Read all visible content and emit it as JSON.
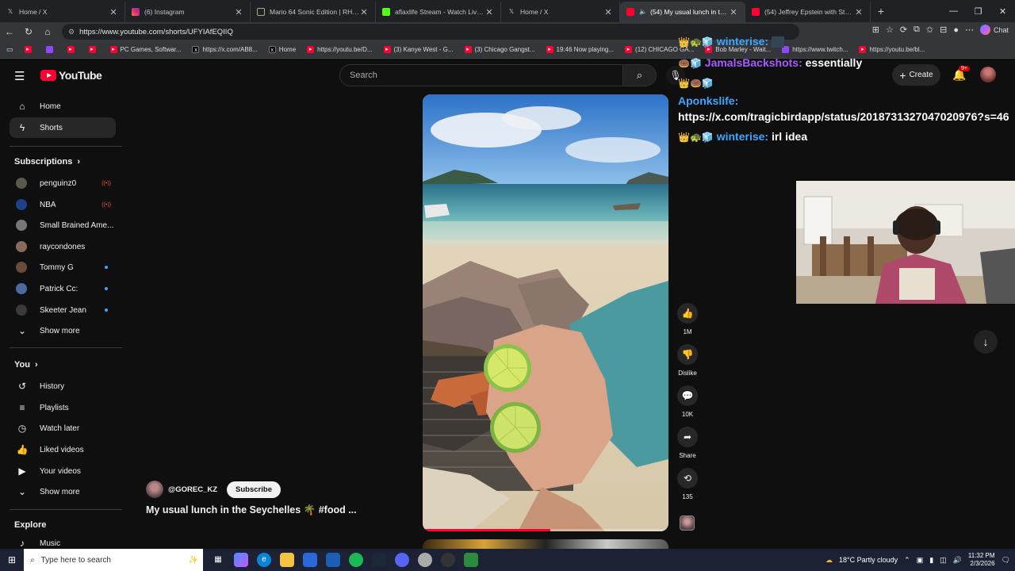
{
  "browser": {
    "tabs": [
      {
        "title": "Home / X",
        "icon": "x-logo-icon",
        "active": false
      },
      {
        "title": "(6) Instagram",
        "icon": "instagram-icon",
        "active": false
      },
      {
        "title": "Mario 64 Sonic Edition | RHDC",
        "icon": "rhdc-icon",
        "active": false
      },
      {
        "title": "aflaxlife Stream - Watch Live on K",
        "icon": "kick-icon",
        "active": false
      },
      {
        "title": "Home / X",
        "icon": "x-logo-icon",
        "active": false
      },
      {
        "title": "(54) My usual lunch in the Se",
        "icon": "youtube-icon",
        "active": true
      },
      {
        "title": "(54) Jeffrey Epstein with Steve Ban",
        "icon": "youtube-icon",
        "active": false
      }
    ],
    "url": "https://www.youtube.com/shorts/UFYIAfEQIIQ",
    "chat_label": "Chat",
    "bookmarks": [
      {
        "label": "",
        "icon": "youtube-icon"
      },
      {
        "label": "",
        "icon": "twitch-icon"
      },
      {
        "label": "",
        "icon": "youtube-icon"
      },
      {
        "label": "",
        "icon": "youtube-icon"
      },
      {
        "label": "PC Games, Softwar...",
        "icon": "youtube-icon"
      },
      {
        "label": "https://x.com/AB8...",
        "icon": "x-logo-icon"
      },
      {
        "label": "Home",
        "icon": "x-logo-icon"
      },
      {
        "label": "https://youtu.be/D...",
        "icon": "youtube-icon"
      },
      {
        "label": "(3) Kanye West - G...",
        "icon": "youtube-icon"
      },
      {
        "label": "(3) Chicago Gangst...",
        "icon": "youtube-icon"
      },
      {
        "label": "19:46 Now playing...",
        "icon": "youtube-icon"
      },
      {
        "label": "(12) CHICAGO GA...",
        "icon": "youtube-icon"
      },
      {
        "label": "Bob Marley - Wait...",
        "icon": "youtube-icon"
      },
      {
        "label": "https://www.twitch...",
        "icon": "twitch-icon"
      },
      {
        "label": "https://youtu.be/bl...",
        "icon": "youtube-icon"
      }
    ]
  },
  "youtube": {
    "logo_text": "YouTube",
    "search_placeholder": "Search",
    "create_label": "Create",
    "notif_badge": "9+",
    "sidebar": {
      "main": [
        {
          "label": "Home",
          "icon": "home-icon",
          "active": false
        },
        {
          "label": "Shorts",
          "icon": "shorts-icon",
          "active": true
        }
      ],
      "subscriptions_header": "Subscriptions",
      "subscriptions": [
        {
          "label": "penguinz0",
          "status": "live",
          "color": "#5a5a4a"
        },
        {
          "label": "NBA",
          "status": "live",
          "color": "#1d428a"
        },
        {
          "label": "Small Brained Ame...",
          "status": "",
          "color": "#777"
        },
        {
          "label": "raycondones",
          "status": "",
          "color": "#8a6a5a"
        },
        {
          "label": "Tommy G",
          "status": "new",
          "color": "#6a4a3a"
        },
        {
          "label": "Patrick Cc:",
          "status": "new",
          "color": "#4a6aa0"
        },
        {
          "label": "Skeeter Jean",
          "status": "new",
          "color": "#3a3a3a"
        }
      ],
      "show_more": "Show more",
      "you_header": "You",
      "you_items": [
        {
          "label": "History",
          "icon": "history-icon"
        },
        {
          "label": "Playlists",
          "icon": "playlists-icon"
        },
        {
          "label": "Watch later",
          "icon": "watch-later-icon"
        },
        {
          "label": "Liked videos",
          "icon": "like-icon"
        },
        {
          "label": "Your videos",
          "icon": "your-videos-icon"
        },
        {
          "label": "Show more",
          "icon": "chevron-down-icon"
        }
      ],
      "explore_header": "Explore",
      "explore_items": [
        {
          "label": "Music",
          "icon": "music-icon"
        }
      ]
    },
    "short": {
      "channel": "@GOREC_KZ",
      "subscribe_label": "Subscribe",
      "title": "My usual lunch in the Seychelles 🌴 #food ...",
      "progress": 0.52,
      "actions": {
        "like_count": "1M",
        "dislike_label": "Dislike",
        "comment_count": "10K",
        "share_label": "Share",
        "remix_count": "135"
      }
    }
  },
  "overlay_chat": [
    {
      "badges": "",
      "user": "winterise:",
      "user_color": "#3fa7ff",
      "message": ""
    },
    {
      "badges": "",
      "user": "JamalsBackshots:",
      "user_color": "#a45cff",
      "message": "essentially"
    },
    {
      "badges": "👑🍩🧊",
      "user": "",
      "user_color": "#ffffff",
      "message": ""
    },
    {
      "badges": "",
      "user": "Aponkslife:",
      "user_color": "#3fa7ff",
      "message": "https://x.com/tragicbirdapp/status/2018731327047020976?s=46"
    },
    {
      "badges": "👑🐢🧊",
      "user": "winterise:",
      "user_color": "#3fa7ff",
      "message": "irl idea"
    }
  ],
  "taskbar": {
    "search_placeholder": "Type here to search",
    "weather": "18°C  Partly cloudy",
    "time": "11:32 PM",
    "date": "2/3/2026"
  }
}
